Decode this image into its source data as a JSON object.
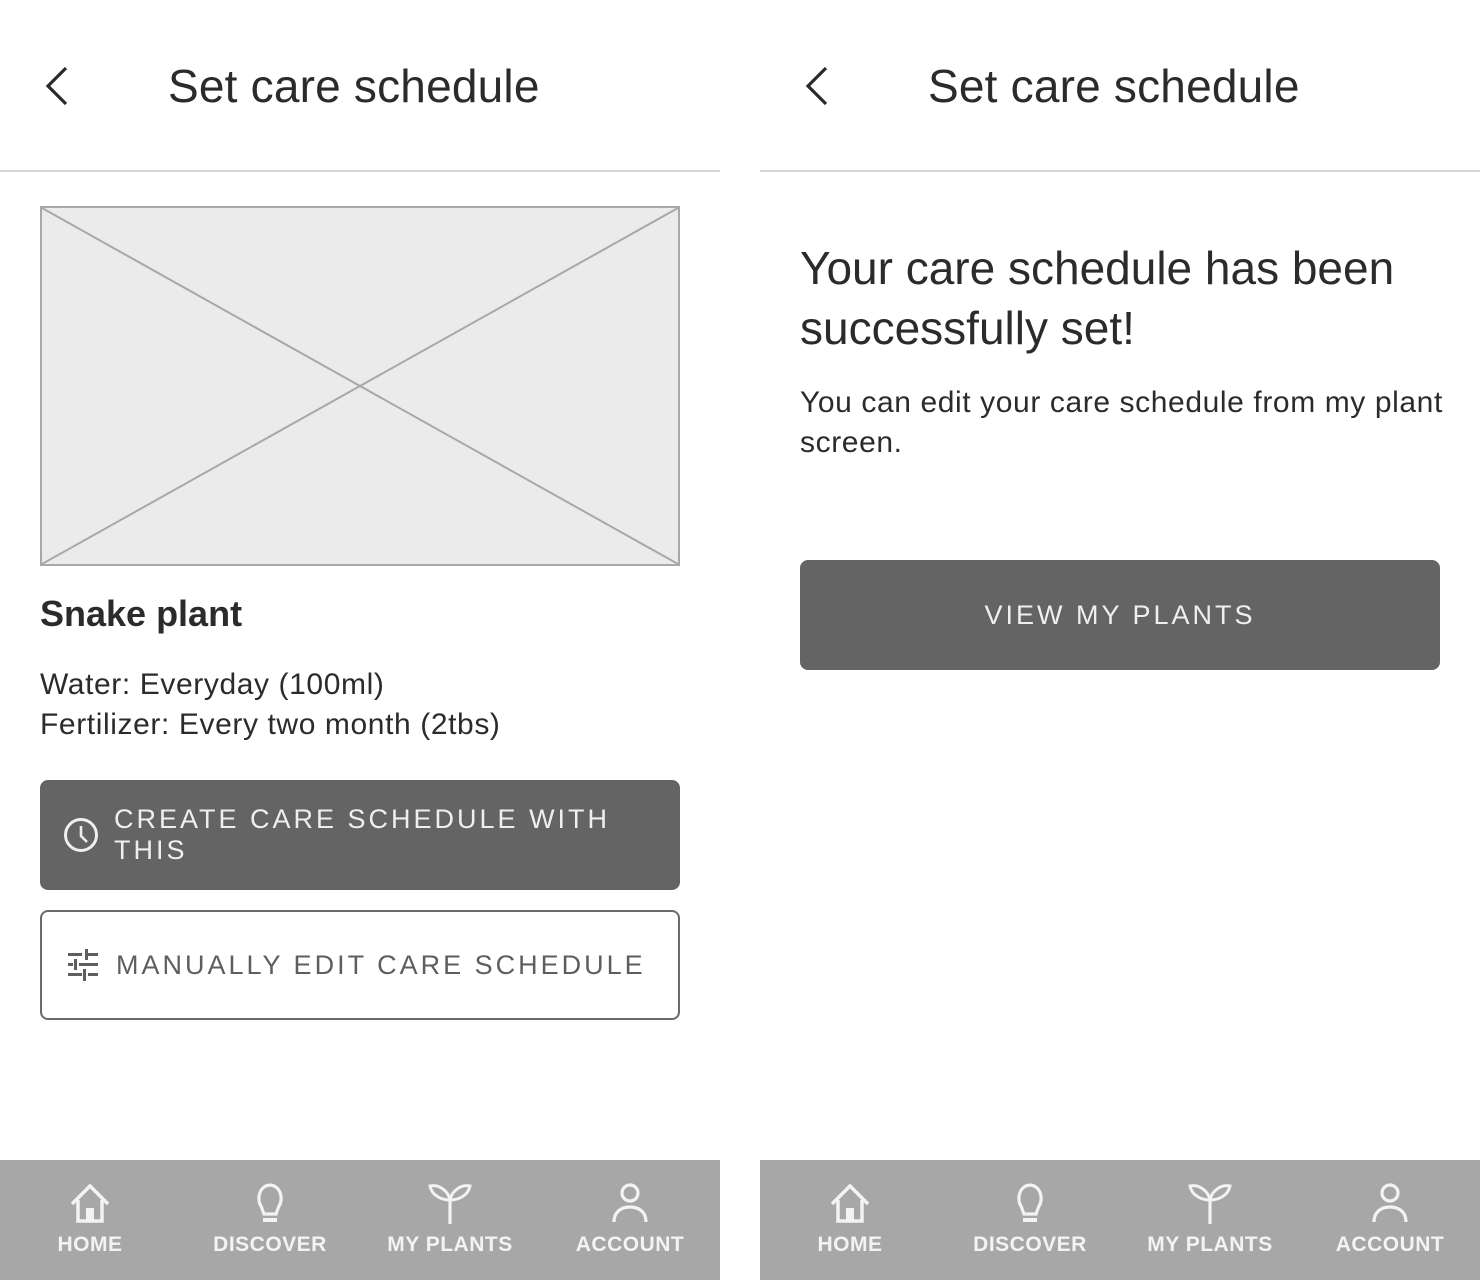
{
  "colors": {
    "primary_button": "#646464",
    "nav_background": "#a7a7a7",
    "placeholder_fill": "#ebebeb",
    "text": "#2b2b2b"
  },
  "screens": [
    {
      "header": {
        "title": "Set care schedule",
        "back_icon": "chevron-left-icon"
      },
      "image": {
        "alt": "plant image placeholder"
      },
      "plant": {
        "name": "Snake plant",
        "care": [
          "Water: Everyday (100ml)",
          "Fertilizer: Every two month (2tbs)"
        ]
      },
      "buttons": {
        "create": {
          "label": "CREATE CARE SCHEDULE WITH THIS",
          "icon": "clock-icon"
        },
        "manual": {
          "label": "MANUALLY EDIT CARE SCHEDULE",
          "icon": "sliders-icon"
        }
      },
      "nav": [
        {
          "label": "HOME",
          "icon": "home-icon"
        },
        {
          "label": "DISCOVER",
          "icon": "lightbulb-icon"
        },
        {
          "label": "MY PLANTS",
          "icon": "sprout-icon"
        },
        {
          "label": "ACCOUNT",
          "icon": "person-icon"
        }
      ]
    },
    {
      "header": {
        "title": "Set care schedule",
        "back_icon": "chevron-left-icon"
      },
      "success": {
        "title": "Your care schedule has been successfully set!",
        "description": "You can edit your care schedule from my plant screen."
      },
      "buttons": {
        "view": {
          "label": "VIEW MY PLANTS"
        }
      },
      "nav": [
        {
          "label": "HOME",
          "icon": "home-icon"
        },
        {
          "label": "DISCOVER",
          "icon": "lightbulb-icon"
        },
        {
          "label": "MY PLANTS",
          "icon": "sprout-icon"
        },
        {
          "label": "ACCOUNT",
          "icon": "person-icon"
        }
      ]
    }
  ]
}
